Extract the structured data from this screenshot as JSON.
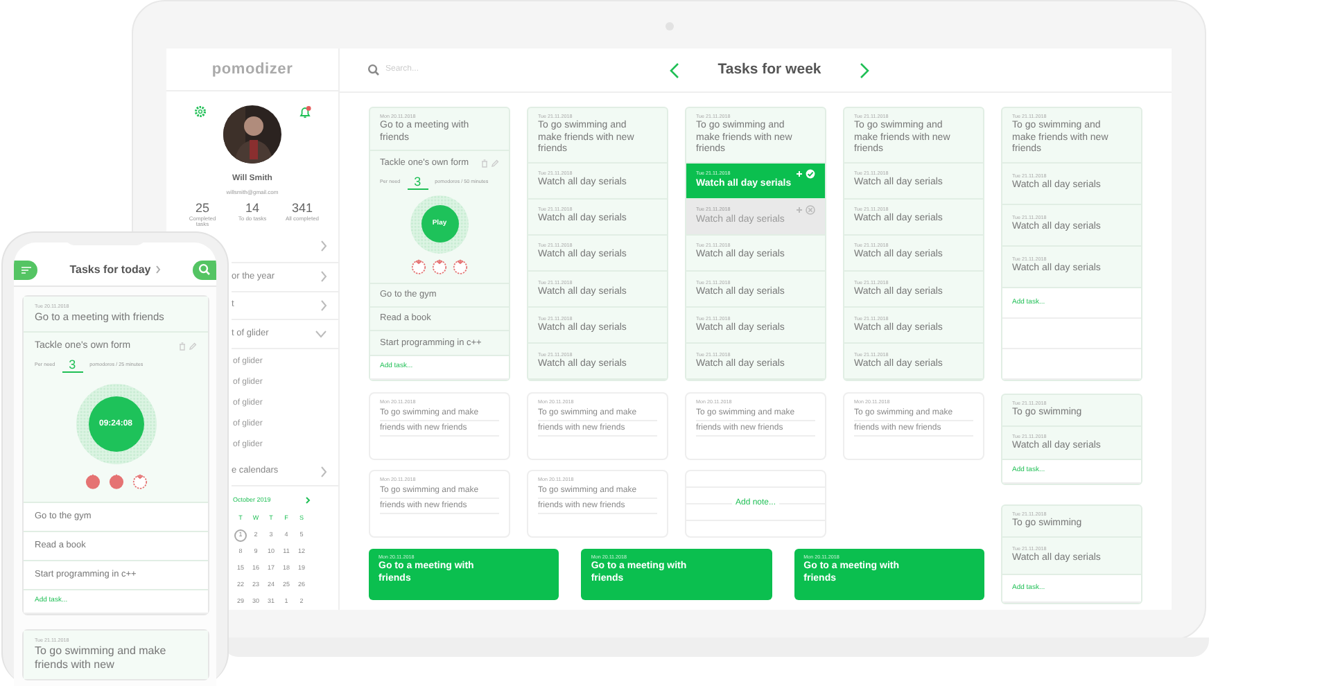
{
  "laptop": {
    "logo": "pomodizer",
    "search": {
      "placeholder": "Search..."
    },
    "profile": {
      "name": "Will Smith",
      "email": "willsmith@gmail.com",
      "notification": true,
      "stats": [
        {
          "value": "25",
          "label": "Completed tasks"
        },
        {
          "value": "14",
          "label": "To do tasks"
        },
        {
          "value": "341",
          "label": "All completed"
        }
      ]
    },
    "menu": [
      {
        "expanded": false
      },
      {
        "label": "or the year",
        "expanded": false
      },
      {
        "label": "t",
        "expanded": false
      },
      {
        "label": "t of glider",
        "expanded": true,
        "children": [
          {
            "label": "of glider"
          },
          {
            "label": "of glider"
          },
          {
            "label": "of glider"
          },
          {
            "label": "of glider"
          },
          {
            "label": "of glider"
          }
        ]
      },
      {
        "label": "e calendars",
        "expanded": false
      }
    ],
    "calendar": {
      "month": "October 2019",
      "weekdays": [
        "T",
        "W",
        "T",
        "F",
        "S"
      ],
      "days": [
        {
          "day": "1",
          "selected": true
        },
        {
          "day": "2",
          "selected": false
        },
        {
          "day": "3",
          "selected": false
        },
        {
          "day": "4",
          "selected": false
        },
        {
          "day": "5",
          "selected": false
        },
        {
          "day": "8",
          "selected": false
        },
        {
          "day": "9",
          "selected": false
        },
        {
          "day": "10",
          "selected": false
        },
        {
          "day": "11",
          "selected": false
        },
        {
          "day": "12",
          "selected": false
        },
        {
          "day": "15",
          "selected": false
        },
        {
          "day": "16",
          "selected": false
        },
        {
          "day": "17",
          "selected": false
        },
        {
          "day": "18",
          "selected": false
        },
        {
          "day": "19",
          "selected": false
        },
        {
          "day": "22",
          "selected": false
        },
        {
          "day": "23",
          "selected": false
        },
        {
          "day": "24",
          "selected": false
        },
        {
          "day": "25",
          "selected": false
        },
        {
          "day": "26",
          "selected": false
        },
        {
          "day": "29",
          "selected": false
        },
        {
          "day": "30",
          "selected": false
        },
        {
          "day": "31",
          "selected": false
        },
        {
          "day": "1",
          "selected": false
        },
        {
          "day": "2",
          "selected": false
        }
      ]
    },
    "week": {
      "title": "Tasks for week",
      "columns": [
        {
          "items": [
            {
              "kind": "task",
              "date": "Mon 20.11.2018",
              "title": "Go to a meeting with friends",
              "done": false,
              "dragging": false
            },
            {
              "kind": "timer",
              "title": "Tackle one's own form",
              "per": "Per need",
              "count": "3",
              "unit": "pomodoros / 50 minutes",
              "button": "Play",
              "tomatoes": [
                {
                  "done": false
                },
                {
                  "done": false
                },
                {
                  "done": false
                }
              ]
            },
            {
              "kind": "plain",
              "title": "Go to the gym"
            },
            {
              "kind": "plain",
              "title": "Read a book"
            },
            {
              "kind": "plain",
              "title": "Start programming in c++"
            },
            {
              "kind": "add",
              "label": "Add task..."
            }
          ]
        },
        {
          "items": [
            {
              "kind": "task",
              "date": "Tue 21.11.2018",
              "title": "To go swimming and make friends with new friends",
              "done": false,
              "dragging": false
            },
            {
              "kind": "task",
              "date": "Tue 21.11.2018",
              "title": "Watch all day serials",
              "done": false,
              "dragging": false
            },
            {
              "kind": "task",
              "date": "Tue 21.11.2018",
              "title": "Watch all day serials",
              "done": false,
              "dragging": false
            },
            {
              "kind": "task",
              "date": "Tue 21.11.2018",
              "title": "Watch all day serials",
              "done": false,
              "dragging": false
            },
            {
              "kind": "task",
              "date": "Tue 21.11.2018",
              "title": "Watch all day serials",
              "done": false,
              "dragging": false
            },
            {
              "kind": "task",
              "date": "Tue 21.11.2018",
              "title": "Watch all day serials",
              "done": false,
              "dragging": false
            },
            {
              "kind": "task",
              "date": "Tue 21.11.2018",
              "title": "Watch all day serials",
              "done": false,
              "dragging": false
            }
          ]
        },
        {
          "items": [
            {
              "kind": "task",
              "date": "Tue 21.11.2018",
              "title": "To go swimming and make friends with new friends",
              "done": false,
              "dragging": false
            },
            {
              "kind": "task",
              "date": "Tue 21.11.2018",
              "title": "Watch all day serials",
              "done": true,
              "dragging": false
            },
            {
              "kind": "task",
              "date": "Tue 21.11.2018",
              "title": "Watch all day serials",
              "done": false,
              "dragging": true
            },
            {
              "kind": "task",
              "date": "Tue 21.11.2018",
              "title": "Watch all day serials",
              "done": false,
              "dragging": false
            },
            {
              "kind": "task",
              "date": "Tue 21.11.2018",
              "title": "Watch all day serials",
              "done": false,
              "dragging": false
            },
            {
              "kind": "task",
              "date": "Tue 21.11.2018",
              "title": "Watch all day serials",
              "done": false,
              "dragging": false
            },
            {
              "kind": "task",
              "date": "Tue 21.11.2018",
              "title": "Watch all day serials",
              "done": false,
              "dragging": false
            }
          ]
        },
        {
          "items": [
            {
              "kind": "task",
              "date": "Tue 21.11.2018",
              "title": "To go swimming and make friends with new friends",
              "done": false,
              "dragging": false
            },
            {
              "kind": "task",
              "date": "Tue 21.11.2018",
              "title": "Watch all day serials",
              "done": false,
              "dragging": false
            },
            {
              "kind": "task",
              "date": "Tue 21.11.2018",
              "title": "Watch all day serials",
              "done": false,
              "dragging": false
            },
            {
              "kind": "task",
              "date": "Tue 21.11.2018",
              "title": "Watch all day serials",
              "done": false,
              "dragging": false
            },
            {
              "kind": "task",
              "date": "Tue 21.11.2018",
              "title": "Watch all day serials",
              "done": false,
              "dragging": false
            },
            {
              "kind": "task",
              "date": "Tue 21.11.2018",
              "title": "Watch all day serials",
              "done": false,
              "dragging": false
            },
            {
              "kind": "task",
              "date": "Tue 21.11.2018",
              "title": "Watch all day serials",
              "done": false,
              "dragging": false
            }
          ]
        },
        {
          "items": [
            {
              "kind": "task",
              "date": "Tue 21.11.2018",
              "title": "To go swimming and make friends with new friends",
              "done": false,
              "dragging": false
            },
            {
              "kind": "task",
              "date": "Tue 21.11.2018",
              "title": "Watch all day serials",
              "done": false,
              "dragging": false
            },
            {
              "kind": "task",
              "date": "Tue 21.11.2018",
              "title": "Watch all day serials",
              "done": false,
              "dragging": false
            },
            {
              "kind": "task",
              "date": "Tue 21.11.2018",
              "title": "Watch all day serials",
              "done": false,
              "dragging": false
            },
            {
              "kind": "add",
              "label": "Add task..."
            },
            {
              "kind": "blank"
            },
            {
              "kind": "blank"
            }
          ]
        }
      ],
      "notes": [
        {
          "kind": "note",
          "date": "Mon 20.11.2018",
          "text": "To go swimming and make friends with new friends"
        },
        {
          "kind": "note",
          "date": "Mon 20.11.2018",
          "text": "To go swimming and make friends with new friends"
        },
        {
          "kind": "note",
          "date": "Mon 20.11.2018",
          "text": "To go swimming and make friends with new friends"
        },
        {
          "kind": "note",
          "date": "Mon 20.11.2018",
          "text": "To go swimming and make friends with new friends"
        },
        {
          "kind": "note",
          "date": "Mon 20.11.2018",
          "text": "To go swimming and make friends with new friends"
        },
        {
          "kind": "note",
          "date": "Mon 20.11.2018",
          "text": "To go swimming and make friends with new friends"
        },
        {
          "kind": "add",
          "label": "Add note..."
        }
      ],
      "highlights": [
        {
          "date": "Mon 20.11.2018",
          "title": "Go to a meeting with friends"
        },
        {
          "date": "Mon 20.11.2018",
          "title": "Go to a meeting with friends"
        },
        {
          "date": "Mon 20.11.2018",
          "title": "Go to a meeting with friends"
        }
      ],
      "side_cards": [
        {
          "items": [
            {
              "kind": "task",
              "date": "Tue 21.11.2018",
              "title": "To go swimming",
              "done": false,
              "dragging": false
            },
            {
              "kind": "task",
              "date": "Tue 21.11.2018",
              "title": "Watch all day serials",
              "done": false,
              "dragging": false
            },
            {
              "kind": "add",
              "label": "Add task..."
            }
          ]
        },
        {
          "items": [
            {
              "kind": "task",
              "date": "Tue 21.11.2018",
              "title": "To go swimming",
              "done": false,
              "dragging": false
            },
            {
              "kind": "task",
              "date": "Tue 21.11.2018",
              "title": "Watch all day serials",
              "done": false,
              "dragging": false
            },
            {
              "kind": "add",
              "label": "Add task..."
            }
          ]
        }
      ]
    }
  },
  "phone": {
    "title": "Tasks for today",
    "card": {
      "items": [
        {
          "kind": "task",
          "date": "Tue 20.11.2018",
          "title": "Go to a meeting with friends",
          "done": false,
          "dragging": false
        },
        {
          "kind": "timer",
          "title": "Tackle one's own form",
          "per": "Per need",
          "count": "3",
          "unit": "pomodoros / 25 minutes",
          "time": "09:24:08",
          "tomatoes": [
            {
              "done": true
            },
            {
              "done": true
            },
            {
              "done": false
            }
          ]
        },
        {
          "kind": "plain",
          "title": "Go to the gym"
        },
        {
          "kind": "plain",
          "title": "Read a book"
        },
        {
          "kind": "plain",
          "title": "Start programming in c++"
        },
        {
          "kind": "add",
          "label": "Add task..."
        }
      ]
    },
    "next_card": {
      "date": "Tue 21.11.2018",
      "title": "To go swimming and make friends with new"
    }
  }
}
